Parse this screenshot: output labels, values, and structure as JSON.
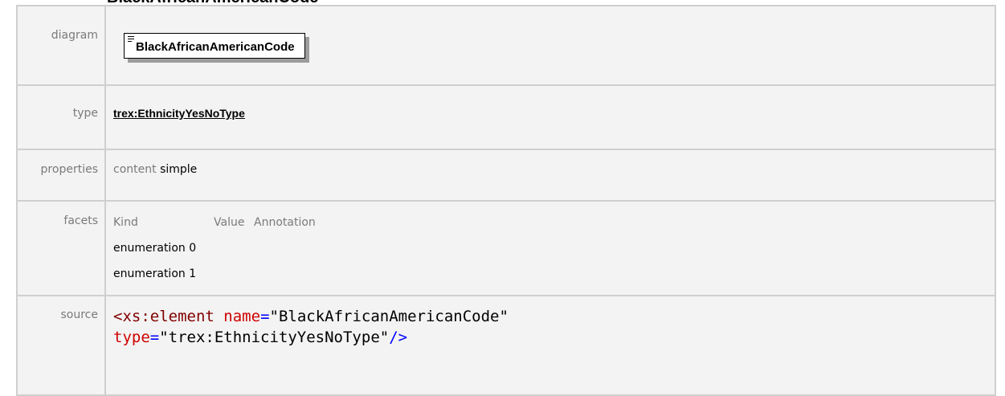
{
  "page_heading": "BlackAfricanAmericanCode",
  "rows": {
    "diagram": {
      "label": "diagram",
      "element_name": "BlackAfricanAmericanCode",
      "icon": "content-lines-icon"
    },
    "type": {
      "label": "type",
      "value": "trex:EthnicityYesNoType"
    },
    "properties": {
      "label": "properties",
      "key": "content",
      "value": "simple"
    },
    "facets": {
      "label": "facets",
      "headers": [
        "Kind",
        "Value",
        "Annotation"
      ],
      "items": [
        {
          "kind": "enumeration",
          "value": "0"
        },
        {
          "kind": "enumeration",
          "value": "1"
        }
      ]
    },
    "source": {
      "label": "source",
      "tag_open": "<xs:element",
      "attr1_name": "name",
      "attr1_value": "\"BlackAfricanAmericanCode\"",
      "attr2_name": "type",
      "attr2_value": "\"trex:EthnicityYesNoType\"",
      "tag_close": "/>",
      "equals": "="
    }
  },
  "colors": {
    "cell_bg": "#f3f3f3",
    "border": "#cfcfcf",
    "label_text": "#7a7a7a",
    "xml_tag": "#800000",
    "xml_attr": "#d00000",
    "xml_punct": "#0000ff"
  }
}
